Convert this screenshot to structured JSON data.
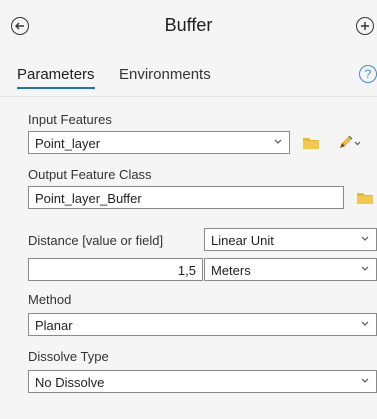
{
  "header": {
    "title": "Buffer"
  },
  "tabs": {
    "parameters": "Parameters",
    "environments": "Environments"
  },
  "help_label": "?",
  "fields": {
    "input_features": {
      "label": "Input Features",
      "value": "Point_layer"
    },
    "output_class": {
      "label": "Output Feature Class",
      "value": "Point_layer_Buffer"
    },
    "distance": {
      "label": "Distance [value or field]",
      "type_value": "Linear Unit",
      "value": "1,5",
      "unit": "Meters"
    },
    "method": {
      "label": "Method",
      "value": "Planar"
    },
    "dissolve": {
      "label": "Dissolve Type",
      "value": "No Dissolve"
    }
  },
  "colors": {
    "accent": "#1a73c8",
    "folder": "#e8b93a",
    "help": "#3f8ad8"
  }
}
